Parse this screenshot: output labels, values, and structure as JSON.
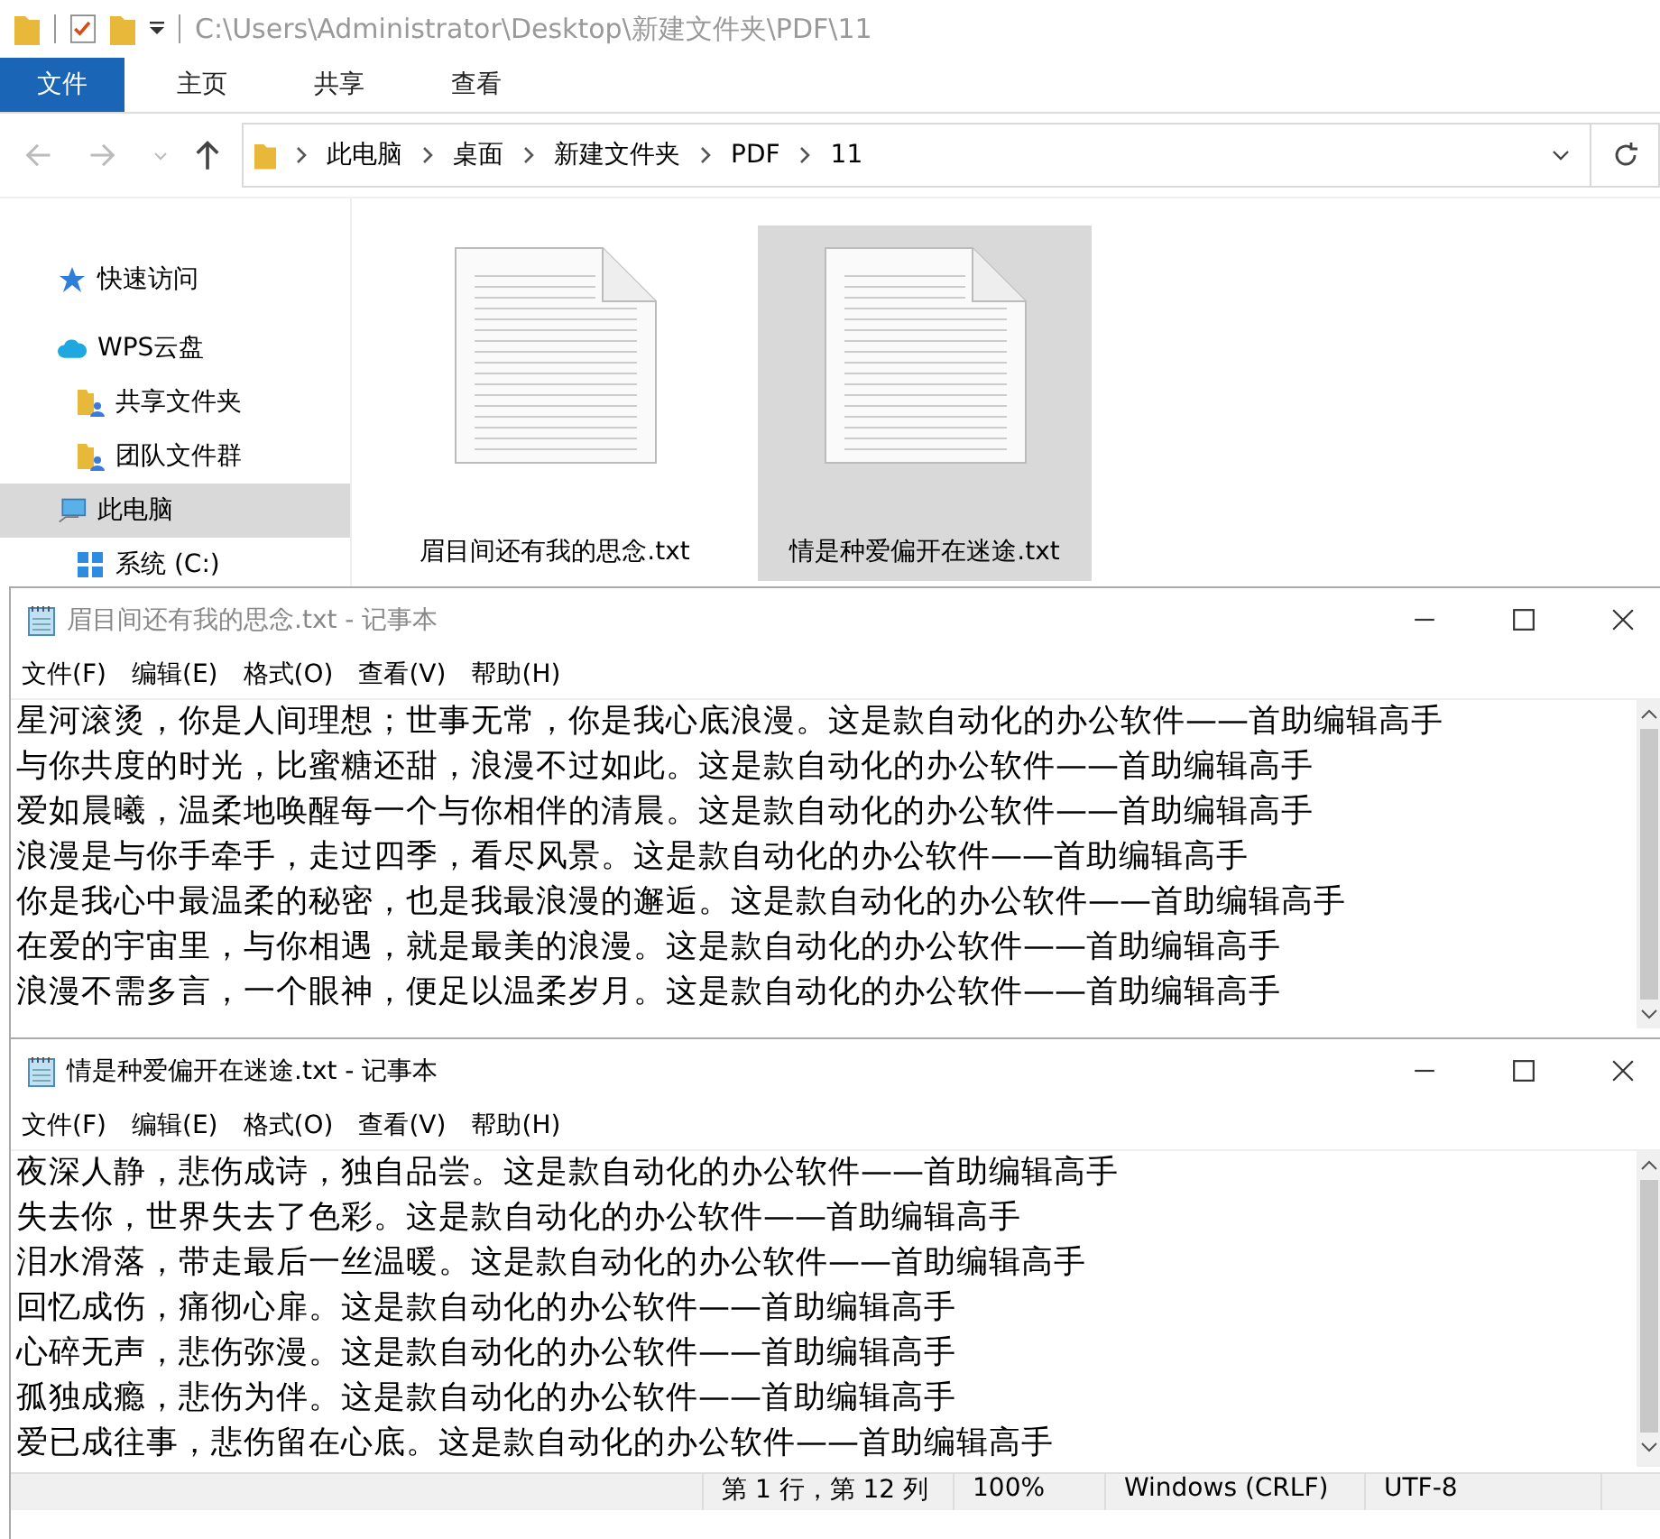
{
  "explorer": {
    "title_path": "C:\\Users\\Administrator\\Desktop\\新建文件夹\\PDF\\11",
    "ribbon_tabs": [
      {
        "label": "文件",
        "selected": true
      },
      {
        "label": "主页",
        "selected": false
      },
      {
        "label": "共享",
        "selected": false
      },
      {
        "label": "查看",
        "selected": false
      }
    ],
    "breadcrumb": [
      "此电脑",
      "桌面",
      "新建文件夹",
      "PDF",
      "11"
    ],
    "sidebar": [
      {
        "label": "快速访问",
        "kind": "star",
        "selected": false
      },
      {
        "label": "WPS云盘",
        "kind": "cloud",
        "selected": false,
        "children": [
          {
            "label": "共享文件夹",
            "kind": "shared",
            "selected": false
          },
          {
            "label": "团队文件群",
            "kind": "team",
            "selected": false
          }
        ]
      },
      {
        "label": "此电脑",
        "kind": "pc",
        "selected": true,
        "children": [
          {
            "label": "系统 (C:)",
            "kind": "drive",
            "selected": false
          }
        ]
      }
    ],
    "files": [
      {
        "name": "眉目间还有我的思念.txt",
        "selected": false
      },
      {
        "name": "情是种爱偏开在迷途.txt",
        "selected": true
      }
    ]
  },
  "notepads": [
    {
      "title": "眉目间还有我的思念.txt - 记事本",
      "menu": [
        "文件(F)",
        "编辑(E)",
        "格式(O)",
        "查看(V)",
        "帮助(H)"
      ],
      "lines": [
        "星河滚烫，你是人间理想；世事无常，你是我心底浪漫。这是款自动化的办公软件——首助编辑高手",
        "与你共度的时光，比蜜糖还甜，浪漫不过如此。这是款自动化的办公软件——首助编辑高手",
        "爱如晨曦，温柔地唤醒每一个与你相伴的清晨。这是款自动化的办公软件——首助编辑高手",
        "浪漫是与你手牵手，走过四季，看尽风景。这是款自动化的办公软件——首助编辑高手",
        "你是我心中最温柔的秘密，也是我最浪漫的邂逅。这是款自动化的办公软件——首助编辑高手",
        "在爱的宇宙里，与你相遇，就是最美的浪漫。这是款自动化的办公软件——首助编辑高手",
        "浪漫不需多言，一个眼神，便足以温柔岁月。这是款自动化的办公软件——首助编辑高手"
      ]
    },
    {
      "title": "情是种爱偏开在迷途.txt - 记事本",
      "menu": [
        "文件(F)",
        "编辑(E)",
        "格式(O)",
        "查看(V)",
        "帮助(H)"
      ],
      "lines": [
        "夜深人静，悲伤成诗，独自品尝。这是款自动化的办公软件——首助编辑高手",
        "失去你，世界失去了色彩。这是款自动化的办公软件——首助编辑高手",
        "泪水滑落，带走最后一丝温暖。这是款自动化的办公软件——首助编辑高手",
        "回忆成伤，痛彻心扉。这是款自动化的办公软件——首助编辑高手",
        "心碎无声，悲伤弥漫。这是款自动化的办公软件——首助编辑高手",
        "孤独成瘾，悲伤为伴。这是款自动化的办公软件——首助编辑高手",
        "爱已成往事，悲伤留在心底。这是款自动化的办公软件——首助编辑高手"
      ],
      "status_bar": [
        "第 1 行，第 12 列",
        "100%",
        "Windows (CRLF)",
        "UTF-8"
      ]
    }
  ]
}
